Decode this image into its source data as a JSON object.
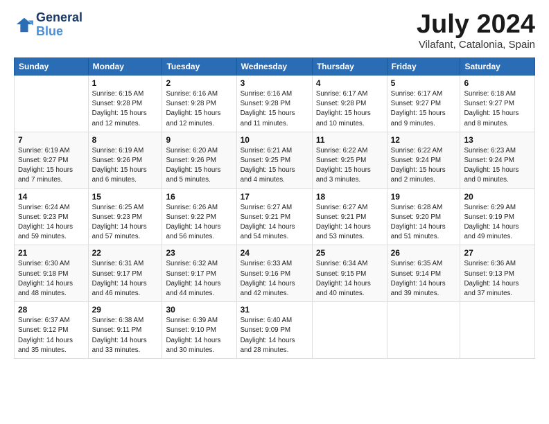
{
  "header": {
    "logo_line1": "General",
    "logo_line2": "Blue",
    "month": "July 2024",
    "location": "Vilafant, Catalonia, Spain"
  },
  "days_of_week": [
    "Sunday",
    "Monday",
    "Tuesday",
    "Wednesday",
    "Thursday",
    "Friday",
    "Saturday"
  ],
  "weeks": [
    [
      {
        "day": "",
        "info": ""
      },
      {
        "day": "1",
        "info": "Sunrise: 6:15 AM\nSunset: 9:28 PM\nDaylight: 15 hours\nand 12 minutes."
      },
      {
        "day": "2",
        "info": "Sunrise: 6:16 AM\nSunset: 9:28 PM\nDaylight: 15 hours\nand 12 minutes."
      },
      {
        "day": "3",
        "info": "Sunrise: 6:16 AM\nSunset: 9:28 PM\nDaylight: 15 hours\nand 11 minutes."
      },
      {
        "day": "4",
        "info": "Sunrise: 6:17 AM\nSunset: 9:28 PM\nDaylight: 15 hours\nand 10 minutes."
      },
      {
        "day": "5",
        "info": "Sunrise: 6:17 AM\nSunset: 9:27 PM\nDaylight: 15 hours\nand 9 minutes."
      },
      {
        "day": "6",
        "info": "Sunrise: 6:18 AM\nSunset: 9:27 PM\nDaylight: 15 hours\nand 8 minutes."
      }
    ],
    [
      {
        "day": "7",
        "info": "Sunrise: 6:19 AM\nSunset: 9:27 PM\nDaylight: 15 hours\nand 7 minutes."
      },
      {
        "day": "8",
        "info": "Sunrise: 6:19 AM\nSunset: 9:26 PM\nDaylight: 15 hours\nand 6 minutes."
      },
      {
        "day": "9",
        "info": "Sunrise: 6:20 AM\nSunset: 9:26 PM\nDaylight: 15 hours\nand 5 minutes."
      },
      {
        "day": "10",
        "info": "Sunrise: 6:21 AM\nSunset: 9:25 PM\nDaylight: 15 hours\nand 4 minutes."
      },
      {
        "day": "11",
        "info": "Sunrise: 6:22 AM\nSunset: 9:25 PM\nDaylight: 15 hours\nand 3 minutes."
      },
      {
        "day": "12",
        "info": "Sunrise: 6:22 AM\nSunset: 9:24 PM\nDaylight: 15 hours\nand 2 minutes."
      },
      {
        "day": "13",
        "info": "Sunrise: 6:23 AM\nSunset: 9:24 PM\nDaylight: 15 hours\nand 0 minutes."
      }
    ],
    [
      {
        "day": "14",
        "info": "Sunrise: 6:24 AM\nSunset: 9:23 PM\nDaylight: 14 hours\nand 59 minutes."
      },
      {
        "day": "15",
        "info": "Sunrise: 6:25 AM\nSunset: 9:23 PM\nDaylight: 14 hours\nand 57 minutes."
      },
      {
        "day": "16",
        "info": "Sunrise: 6:26 AM\nSunset: 9:22 PM\nDaylight: 14 hours\nand 56 minutes."
      },
      {
        "day": "17",
        "info": "Sunrise: 6:27 AM\nSunset: 9:21 PM\nDaylight: 14 hours\nand 54 minutes."
      },
      {
        "day": "18",
        "info": "Sunrise: 6:27 AM\nSunset: 9:21 PM\nDaylight: 14 hours\nand 53 minutes."
      },
      {
        "day": "19",
        "info": "Sunrise: 6:28 AM\nSunset: 9:20 PM\nDaylight: 14 hours\nand 51 minutes."
      },
      {
        "day": "20",
        "info": "Sunrise: 6:29 AM\nSunset: 9:19 PM\nDaylight: 14 hours\nand 49 minutes."
      }
    ],
    [
      {
        "day": "21",
        "info": "Sunrise: 6:30 AM\nSunset: 9:18 PM\nDaylight: 14 hours\nand 48 minutes."
      },
      {
        "day": "22",
        "info": "Sunrise: 6:31 AM\nSunset: 9:17 PM\nDaylight: 14 hours\nand 46 minutes."
      },
      {
        "day": "23",
        "info": "Sunrise: 6:32 AM\nSunset: 9:17 PM\nDaylight: 14 hours\nand 44 minutes."
      },
      {
        "day": "24",
        "info": "Sunrise: 6:33 AM\nSunset: 9:16 PM\nDaylight: 14 hours\nand 42 minutes."
      },
      {
        "day": "25",
        "info": "Sunrise: 6:34 AM\nSunset: 9:15 PM\nDaylight: 14 hours\nand 40 minutes."
      },
      {
        "day": "26",
        "info": "Sunrise: 6:35 AM\nSunset: 9:14 PM\nDaylight: 14 hours\nand 39 minutes."
      },
      {
        "day": "27",
        "info": "Sunrise: 6:36 AM\nSunset: 9:13 PM\nDaylight: 14 hours\nand 37 minutes."
      }
    ],
    [
      {
        "day": "28",
        "info": "Sunrise: 6:37 AM\nSunset: 9:12 PM\nDaylight: 14 hours\nand 35 minutes."
      },
      {
        "day": "29",
        "info": "Sunrise: 6:38 AM\nSunset: 9:11 PM\nDaylight: 14 hours\nand 33 minutes."
      },
      {
        "day": "30",
        "info": "Sunrise: 6:39 AM\nSunset: 9:10 PM\nDaylight: 14 hours\nand 30 minutes."
      },
      {
        "day": "31",
        "info": "Sunrise: 6:40 AM\nSunset: 9:09 PM\nDaylight: 14 hours\nand 28 minutes."
      },
      {
        "day": "",
        "info": ""
      },
      {
        "day": "",
        "info": ""
      },
      {
        "day": "",
        "info": ""
      }
    ]
  ]
}
